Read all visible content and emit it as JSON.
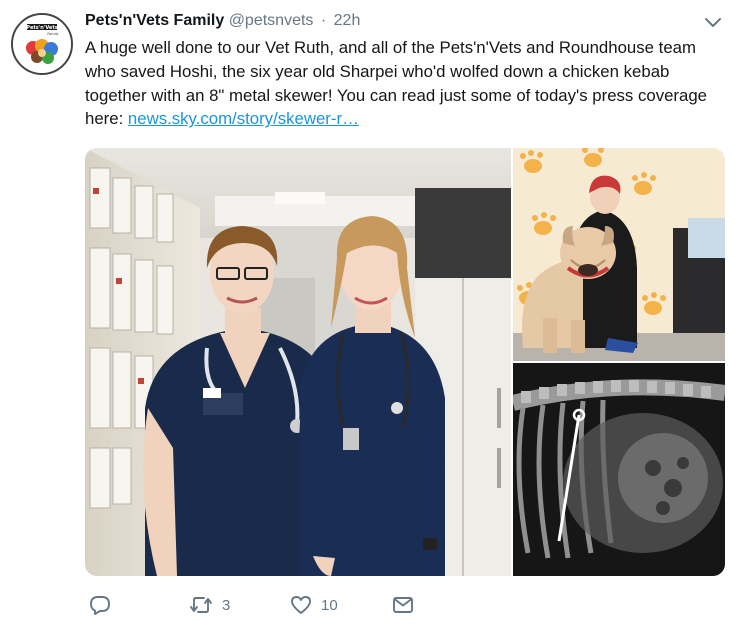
{
  "tweet": {
    "display_name": "Pets'n'Vets Family",
    "handle": "@petsnvets",
    "separator": "·",
    "time": "22h",
    "avatar_text": "Pets'n'Vets Family",
    "text": "A huge well done to our Vet Ruth, and all of the Pets'n'Vets and Roundhouse team who saved Hoshi, the six year old Sharpei who'd wolfed down a chicken kebab together with an 8\" metal skewer! You can read just some of today's press coverage here: ",
    "link": "news.sky.com/story/skewer-r…"
  },
  "actions": {
    "reply_icon": "reply-icon",
    "retweet_icon": "retweet-icon",
    "retweet_count": "3",
    "like_icon": "heart-icon",
    "like_count": "10",
    "dm_icon": "envelope-icon"
  },
  "colors": {
    "text": "#14171a",
    "muted": "#657786",
    "link": "#1b95e0",
    "uniform": "#1a2a4a"
  }
}
